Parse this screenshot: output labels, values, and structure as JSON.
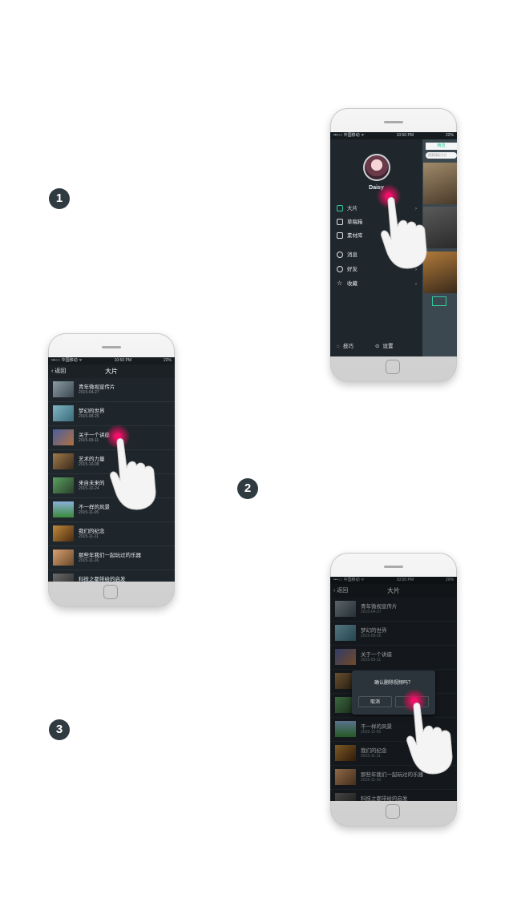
{
  "steps": [
    "1",
    "2",
    "3"
  ],
  "status_bar": {
    "carrier": "•••○○ 中国移动 ᯤ",
    "time": "10:50 PM",
    "battery_1": "22%",
    "battery_2": "22%",
    "battery_3": "20%"
  },
  "phone1": {
    "username": "Daisy",
    "menu": [
      {
        "label": "大片",
        "icon": "film-icon",
        "active": true
      },
      {
        "label": "草稿箱",
        "icon": "draft-icon",
        "active": false
      },
      {
        "label": "素材库",
        "icon": "folder-icon",
        "active": false
      },
      {
        "label": "消息",
        "icon": "chat-icon",
        "active": false
      },
      {
        "label": "好友",
        "icon": "friends-icon",
        "active": false
      },
      {
        "label": "收藏",
        "icon": "star-icon",
        "active": false
      }
    ],
    "bottom": {
      "tips": "技巧",
      "settings": "设置"
    },
    "panel": {
      "tab": "精选",
      "search_placeholder": "搜索精彩大片"
    }
  },
  "list_screen": {
    "back": "返回",
    "title": "大片",
    "items": [
      {
        "title": "青年微视宣传片",
        "date": "2015-04-27"
      },
      {
        "title": "梦幻的世界",
        "date": "2015-08-26"
      },
      {
        "title": "关于一个讲座",
        "date": "2015-09-11"
      },
      {
        "title": "艺术的力量",
        "date": "2015-10-08"
      },
      {
        "title": "来自未来的",
        "date": "2015-10-24"
      },
      {
        "title": "不一样的风景",
        "date": "2015-11-05"
      },
      {
        "title": "我们的纪念",
        "date": "2015-11-11"
      },
      {
        "title": "那些年我们一起玩过的乐器",
        "date": "2015-11-16"
      },
      {
        "title": "科技之都带给的启发",
        "date": ""
      }
    ]
  },
  "dialog": {
    "message": "确认删除视频吗？",
    "cancel": "取消"
  },
  "colors": {
    "accent": "#f10f6a",
    "green": "#36c89a",
    "screen_bg": "#1f262b"
  }
}
